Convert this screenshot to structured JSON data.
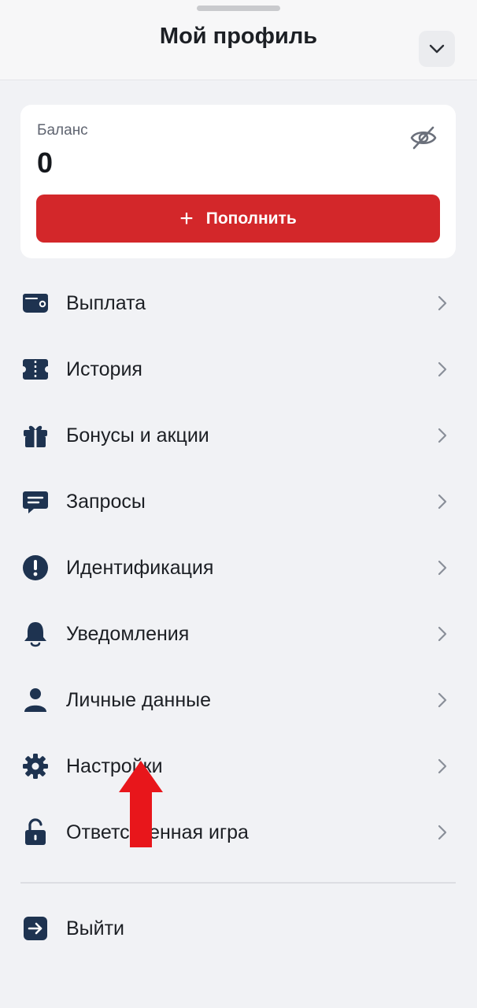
{
  "header": {
    "title": "Мой профиль",
    "collapse_icon": "chevron-down-icon"
  },
  "balance": {
    "label": "Баланс",
    "value": "0",
    "visibility_icon": "eye-off-icon",
    "topup_label": "Пополнить",
    "topup_icon": "plus-icon"
  },
  "menu": {
    "items": [
      {
        "label": "Выплата",
        "icon": "wallet-icon"
      },
      {
        "label": "История",
        "icon": "history-ticket-icon"
      },
      {
        "label": "Бонусы и акции",
        "icon": "gift-icon"
      },
      {
        "label": "Запросы",
        "icon": "chat-icon"
      },
      {
        "label": "Идентификация",
        "icon": "alert-circle-icon"
      },
      {
        "label": "Уведомления",
        "icon": "bell-icon"
      },
      {
        "label": "Личные данные",
        "icon": "user-icon"
      },
      {
        "label": "Настройки",
        "icon": "gear-icon"
      },
      {
        "label": "Ответственная игра",
        "icon": "unlock-icon"
      }
    ],
    "logout_label": "Выйти",
    "logout_icon": "logout-icon"
  },
  "colors": {
    "accent": "#d3272a",
    "icon": "#1e3350",
    "background": "#f1f2f5",
    "annotation_arrow": "#e8161b"
  }
}
